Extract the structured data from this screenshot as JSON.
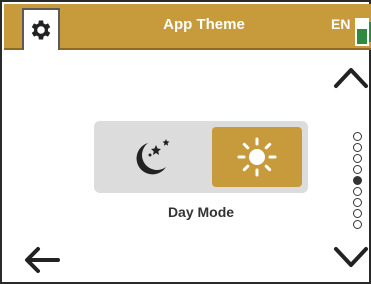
{
  "header": {
    "title": "App Theme",
    "language": "EN",
    "battery_level": 0.62,
    "accent_color": "#c79b3c"
  },
  "theme_toggle": {
    "options": [
      {
        "id": "night",
        "icon": "moon-stars-icon"
      },
      {
        "id": "day",
        "icon": "sun-icon"
      }
    ],
    "selected": "day",
    "label": "Day Mode"
  },
  "navigation": {
    "icons": [
      "settings-icon",
      "chevron-up-icon",
      "chevron-down-icon",
      "back-arrow-icon"
    ]
  },
  "pager": {
    "total": 9,
    "active_index": 4
  }
}
